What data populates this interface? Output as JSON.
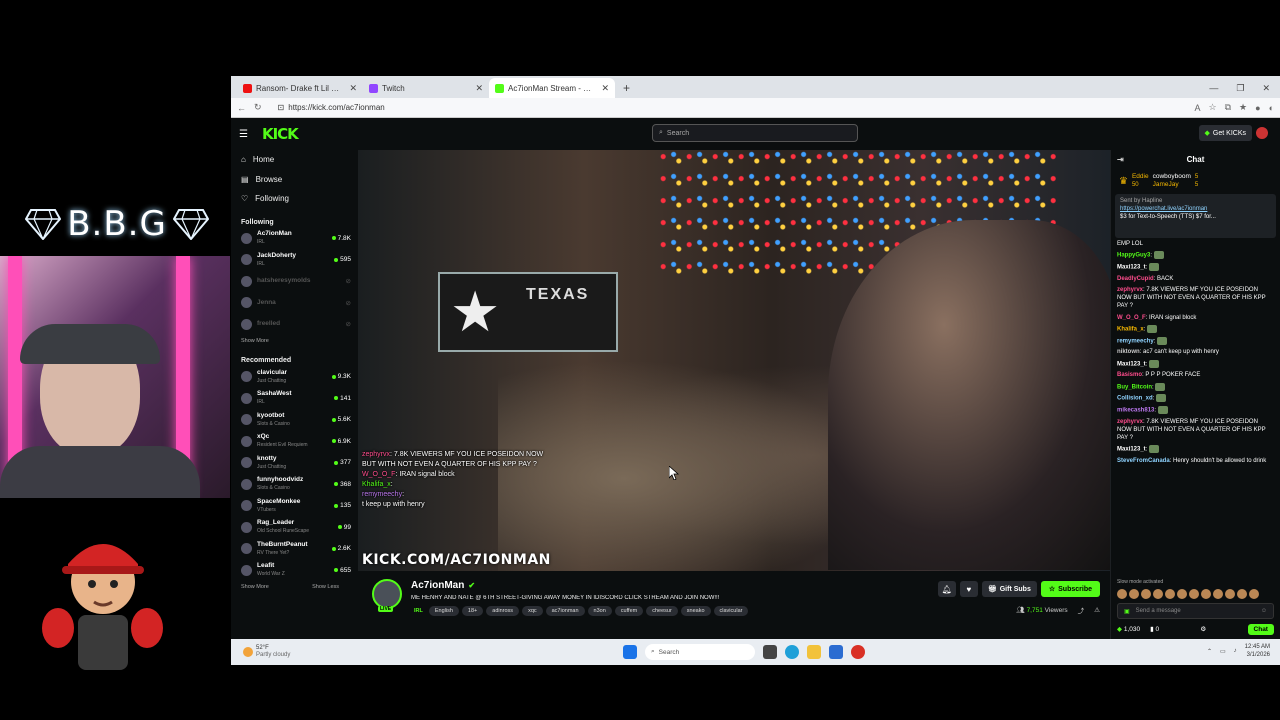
{
  "overlay": {
    "brand_text": "B.B.G"
  },
  "browser": {
    "tabs": [
      {
        "label": "Ransom- Drake ft Lil Wayne - You",
        "color": "#e11"
      },
      {
        "label": "Twitch",
        "color": "#9146ff"
      },
      {
        "label": "Ac7ionMan Stream - Watch L",
        "color": "#53fc18"
      }
    ],
    "url": "https://kick.com/ac7ionman"
  },
  "kick": {
    "logo": "KICK",
    "search_placeholder": "Search",
    "get_kicks": "Get KICKs",
    "accent": "#53fc18"
  },
  "sidebar": {
    "nav": [
      {
        "label": "Home",
        "icon": "home-icon"
      },
      {
        "label": "Browse",
        "icon": "browse-icon"
      },
      {
        "label": "Following",
        "icon": "heart-icon"
      }
    ],
    "following_header": "Following",
    "following": [
      {
        "name": "Ac7ionMan",
        "category": "IRL",
        "viewers": "7.8K",
        "live": true
      },
      {
        "name": "JackDoherty",
        "category": "IRL",
        "viewers": "595",
        "live": true
      },
      {
        "name": "hatsheresymolds",
        "category": "",
        "viewers": "",
        "live": false
      },
      {
        "name": "Jenna",
        "category": "",
        "viewers": "",
        "live": false
      },
      {
        "name": "freelled",
        "category": "",
        "viewers": "",
        "live": false
      }
    ],
    "show_more": "Show More",
    "recommended_header": "Recommended",
    "recommended": [
      {
        "name": "clavicular",
        "category": "Just Chatting",
        "viewers": "9.3K"
      },
      {
        "name": "SashaWest",
        "category": "IRL",
        "viewers": "141"
      },
      {
        "name": "kyootbot",
        "category": "Slots & Casino",
        "viewers": "5.6K"
      },
      {
        "name": "xQc",
        "category": "Resident Evil Requiem",
        "viewers": "6.9K"
      },
      {
        "name": "knotty",
        "category": "Just Chatting",
        "viewers": "377"
      },
      {
        "name": "funnyhoodvidz",
        "category": "Slots & Casino",
        "viewers": "368"
      },
      {
        "name": "SpaceMonkee",
        "category": "VTubers",
        "viewers": "135"
      },
      {
        "name": "Rag_Leader",
        "category": "Old School RuneScape",
        "viewers": "99"
      },
      {
        "name": "TheBurntPeanut",
        "category": "RV There Yet?",
        "viewers": "2.6K"
      },
      {
        "name": "Leafit",
        "category": "World War Z",
        "viewers": "655"
      }
    ],
    "show_more_2": "Show More",
    "show_less": "Show Less"
  },
  "player": {
    "sign_text": "TEXAS",
    "overlay_chat": [
      {
        "user": "zephyrvx",
        "text": ": 7.8K VIEWERS MF YOU ICE POSEIDON NOW BUT WITH NOT EVEN A QUARTER OF HIS KPP PAY ?"
      },
      {
        "user": "W_O_O_F",
        "text": ": IRAN signal block"
      },
      {
        "user": "Khalifa_x",
        "text": ":"
      },
      {
        "user": "remymeechy",
        "text": ":"
      },
      {
        "user": "",
        "text": "t keep up with henry"
      }
    ],
    "watermark": "KICK.COM/AC7IONMAN"
  },
  "stream": {
    "name": "Ac7ionMan",
    "live_label": "LIVE",
    "title": "ME HENRY AND NATE @ 6TH STREET-GIVING AWAY MONEY IN IDISCORD CLICK STREAM AND JOIN NOW!!!",
    "category": "IRL",
    "tags": [
      "English",
      "18+",
      "adinross",
      "xqc",
      "ac7ionman",
      "n3on",
      "cuffem",
      "cheesur",
      "sneako",
      "clavicular"
    ],
    "gift_subs": "Gift Subs",
    "subscribe": "Subscribe",
    "viewers": "7,751",
    "viewers_label": "Viewers"
  },
  "chat": {
    "header": "Chat",
    "pinned_users": [
      {
        "name": "Eddie",
        "amount": "50"
      },
      {
        "name": "cowboyboom",
        "amount": "5"
      },
      {
        "name": "JameJay",
        "amount": "5"
      }
    ],
    "pinned_sender": "Sent by Hapline",
    "pinned_link": "https://powerchat.live/ac7ionman",
    "pinned_text": "$3 for Text-to-Speech (TTS) $7 for...",
    "messages": [
      {
        "user": "",
        "color": "#ff4d8d",
        "text": "EMP LOL"
      },
      {
        "user": "HappyGuy3",
        "color": "#53fc18",
        "text": ":"
      },
      {
        "user": "Maxi123_t",
        "color": "#fff",
        "text": ":"
      },
      {
        "user": "DeadlyCupid",
        "color": "#ff4d8d",
        "text": ": BACK"
      },
      {
        "user": "zephyrvx",
        "color": "#ff4d8d",
        "text": ": 7.8K VIEWERS MF YOU ICE POSEIDON NOW BUT WITH NOT EVEN A QUARTER OF HIS KPP PAY ?"
      },
      {
        "user": "W_O_O_F",
        "color": "#ff4d8d",
        "text": ": IRAN signal block"
      },
      {
        "user": "Khalifa_x",
        "color": "#f5b800",
        "text": ":"
      },
      {
        "user": "remymeechy",
        "color": "#8fd3ff",
        "text": ":"
      },
      {
        "user": "niktown",
        "color": "#ccc",
        "text": ": ac7 can't keep up with henry"
      },
      {
        "user": "Maxi123_t",
        "color": "#fff",
        "text": ":"
      },
      {
        "user": "Basismo",
        "color": "#ff4d8d",
        "text": ": P P P POKER FACE"
      },
      {
        "user": "Buy_Bitcoin",
        "color": "#53fc18",
        "text": ":"
      },
      {
        "user": "Collision_xd",
        "color": "#8fd3ff",
        "text": ":"
      },
      {
        "user": "mikecash813",
        "color": "#b7e",
        "text": ":"
      },
      {
        "user": "zephyrvx",
        "color": "#ff4d8d",
        "text": ": 7.8K VIEWERS MF YOU ICE POSEIDON NOW BUT WITH NOT EVEN A QUARTER OF HIS KPP PAY ?"
      },
      {
        "user": "Maxi123_t",
        "color": "#fff",
        "text": ":"
      },
      {
        "user": "SteveFromCanada",
        "color": "#8fd3ff",
        "text": ": Henry shouldn't be allowed to drink"
      }
    ],
    "slow_mode": "Slow mode activated",
    "send_placeholder": "Send a message",
    "kicks_count": "1,030",
    "other_count": "0",
    "chat_button": "Chat"
  },
  "taskbar": {
    "temp": "52°F",
    "weather": "Partly cloudy",
    "search": "Search",
    "time": "12:45 AM",
    "date": "3/1/2026"
  }
}
